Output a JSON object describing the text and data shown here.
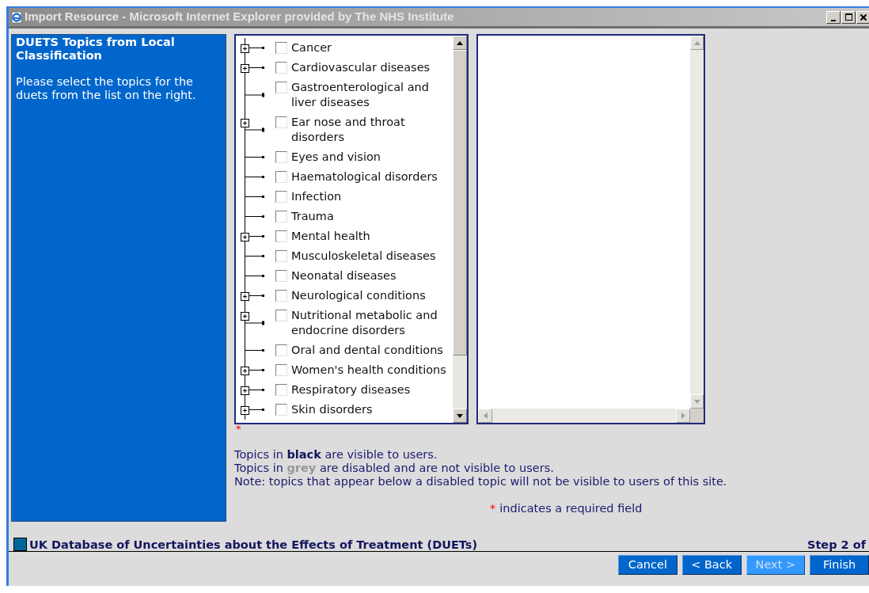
{
  "window": {
    "title": "Import Resource - Microsoft Internet Explorer provided by The NHS Institute"
  },
  "sidebar": {
    "title": "DUETS Topics from Local Classification",
    "description": "Please select the topics for the duets from the list on the right."
  },
  "topics": [
    {
      "label": "Cancer",
      "kind": "expandable",
      "checked": false
    },
    {
      "label": "Cardiovascular diseases",
      "kind": "expandable",
      "checked": false
    },
    {
      "label": "Gastroenterological and liver diseases",
      "kind": "leaf",
      "checked": false
    },
    {
      "label": "Ear nose and throat disorders",
      "kind": "expandable",
      "checked": false
    },
    {
      "label": "Eyes and vision",
      "kind": "leaf",
      "checked": false
    },
    {
      "label": "Haematological disorders",
      "kind": "leaf",
      "checked": false
    },
    {
      "label": "Infection",
      "kind": "leaf",
      "checked": false
    },
    {
      "label": "Trauma",
      "kind": "leaf",
      "checked": false
    },
    {
      "label": "Mental health",
      "kind": "expandable",
      "checked": false
    },
    {
      "label": "Musculoskeletal diseases",
      "kind": "leaf",
      "checked": false
    },
    {
      "label": "Neonatal diseases",
      "kind": "leaf",
      "checked": false
    },
    {
      "label": "Neurological conditions",
      "kind": "expandable",
      "checked": false
    },
    {
      "label": "Nutritional metabolic and endocrine disorders",
      "kind": "expandable",
      "checked": false
    },
    {
      "label": "Oral and dental conditions",
      "kind": "leaf",
      "checked": false
    },
    {
      "label": "Women's health conditions",
      "kind": "expandable",
      "checked": false
    },
    {
      "label": "Respiratory diseases",
      "kind": "expandable",
      "checked": false
    },
    {
      "label": "Skin disorders",
      "kind": "expandable",
      "checked": false
    }
  ],
  "required_mark": "*",
  "notes": [
    {
      "kind": "visible",
      "text": "Topics in **black** are visible to users."
    },
    {
      "kind": "disabled",
      "text": "Topics in **grey** are disabled and are not visible to users."
    },
    {
      "kind": "plain",
      "text": "Note: topics that appear below a disabled topic will not be visible to users of this site."
    }
  ],
  "required_legend": {
    "mark": "*",
    "text": "indicates a required field"
  },
  "footer": {
    "title": "UK Database of Uncertainties about the Effects of Treatment (DUETs)",
    "step": "Step 2 of"
  },
  "buttons": [
    {
      "label": "Cancel",
      "disabled": false
    },
    {
      "label": "< Back",
      "disabled": false
    },
    {
      "label": "Next >",
      "disabled": true
    },
    {
      "label": "Finish",
      "disabled": false
    }
  ]
}
